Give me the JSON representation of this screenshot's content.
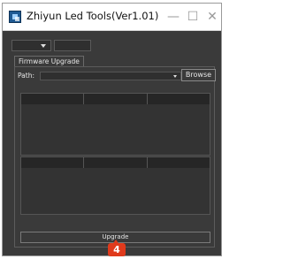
{
  "window": {
    "title": "Zhiyun Led Tools(Ver1.01)",
    "minimize_symbol": "—",
    "maximize_symbol": "☐",
    "close_symbol": "✕"
  },
  "top_controls": {
    "port_combo_value": "",
    "baud_field_value": ""
  },
  "tabs": [
    {
      "label": "Firmware Upgrade",
      "active": true
    }
  ],
  "firmware": {
    "path_label": "Path:",
    "path_value": "",
    "browse_label": "Browse",
    "upgrade_label": "Upgrade"
  },
  "tables": [
    {
      "columns": [
        "",
        "",
        ""
      ],
      "rows": []
    },
    {
      "columns": [
        "",
        "",
        ""
      ],
      "rows": []
    }
  ],
  "annotation": {
    "badge": "4",
    "color": "#e03a1c"
  },
  "colors": {
    "background": "#3a3a3a",
    "titlebar": "#ffffff",
    "table_header": "#262626",
    "table_body": "#333333",
    "text": "#e6e6e6"
  }
}
